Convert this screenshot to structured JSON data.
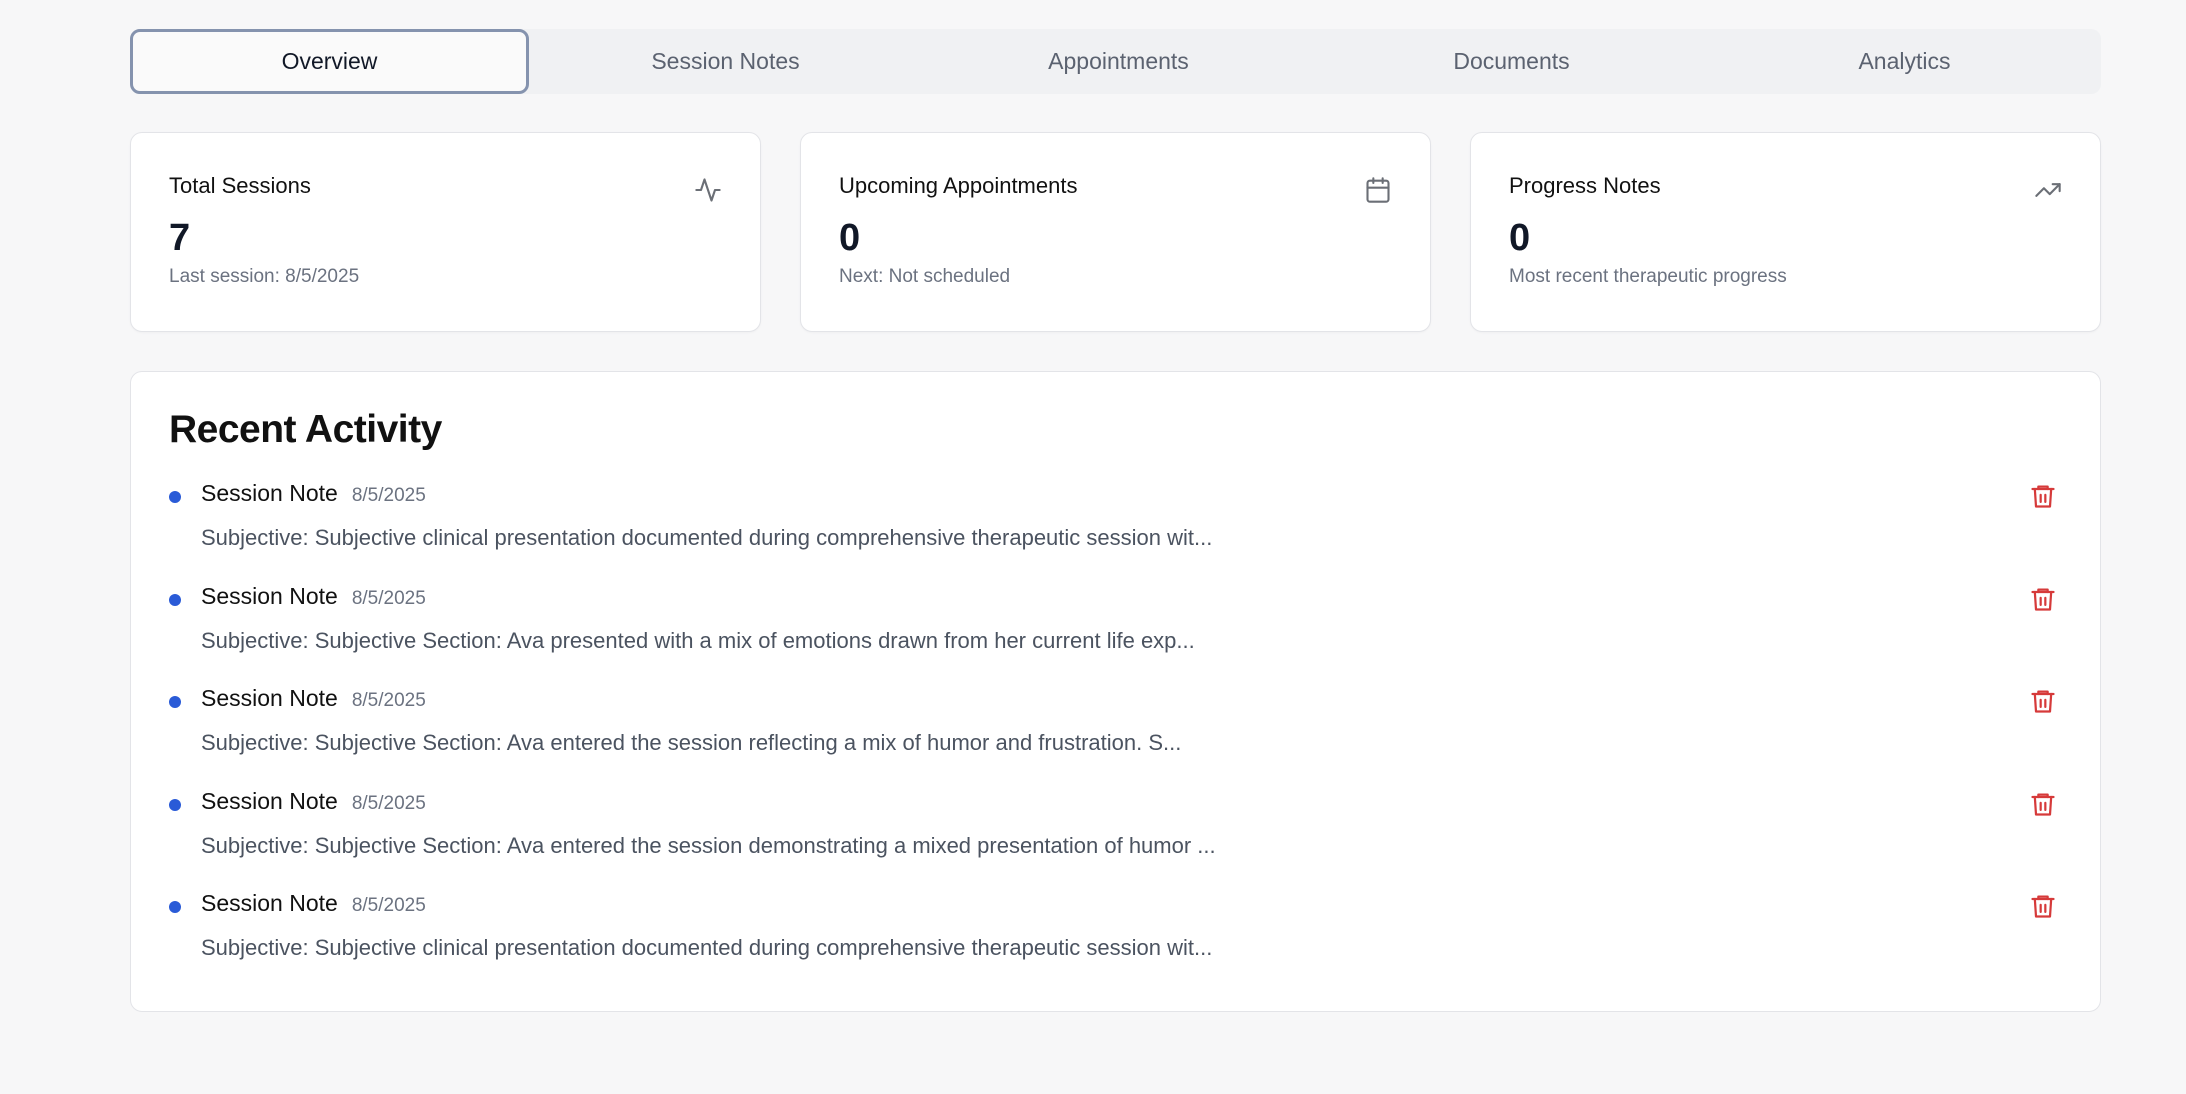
{
  "tabs": [
    {
      "label": "Overview",
      "active": true
    },
    {
      "label": "Session Notes"
    },
    {
      "label": "Appointments"
    },
    {
      "label": "Documents"
    },
    {
      "label": "Analytics"
    }
  ],
  "cards": [
    {
      "title": "Total Sessions",
      "value": "7",
      "sub": "Last session: 8/5/2025",
      "icon": "activity-icon"
    },
    {
      "title": "Upcoming Appointments",
      "value": "0",
      "sub": "Next: Not scheduled",
      "icon": "calendar-icon"
    },
    {
      "title": "Progress Notes",
      "value": "0",
      "sub": "Most recent therapeutic progress",
      "icon": "trending-up-icon"
    }
  ],
  "activity": {
    "title": "Recent Activity",
    "items": [
      {
        "title": "Session Note",
        "date": "8/5/2025",
        "text": "Subjective: Subjective clinical presentation documented during comprehensive therapeutic session wit..."
      },
      {
        "title": "Session Note",
        "date": "8/5/2025",
        "text": "Subjective: Subjective Section: Ava presented with a mix of emotions drawn from her current life exp..."
      },
      {
        "title": "Session Note",
        "date": "8/5/2025",
        "text": "Subjective: Subjective Section: Ava entered the session reflecting a mix of humor and frustration. S..."
      },
      {
        "title": "Session Note",
        "date": "8/5/2025",
        "text": "Subjective: Subjective Section: Ava entered the session demonstrating a mixed presentation of humor ..."
      },
      {
        "title": "Session Note",
        "date": "8/5/2025",
        "text": "Subjective: Subjective clinical presentation documented during comprehensive therapeutic session wit..."
      }
    ]
  },
  "colors": {
    "accent_dot": "#2a5bd7",
    "delete": "#d63a3a",
    "active_tab_border": "#8593ae"
  }
}
